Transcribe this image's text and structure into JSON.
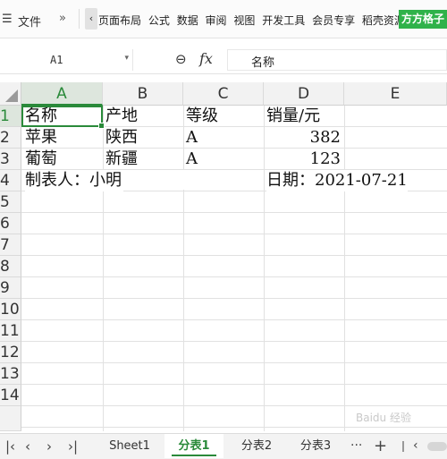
{
  "ribbon": {
    "file_label": "文件",
    "more_label": "»",
    "menus": [
      "页面布局",
      "公式",
      "数据",
      "审阅",
      "视图",
      "开发工具",
      "会员专享",
      "稻壳资源"
    ],
    "special_label": "方方格子"
  },
  "formula_bar": {
    "name_box": "A1",
    "fx_label": "fx",
    "content": "名称"
  },
  "columns": [
    "A",
    "B",
    "C",
    "D",
    "E"
  ],
  "rows": [
    "1",
    "2",
    "3",
    "4",
    "5",
    "6",
    "7",
    "8",
    "9",
    "10",
    "11",
    "12",
    "13",
    "14"
  ],
  "cells": {
    "r1": {
      "a": "名称",
      "b": "产地",
      "c": "等级",
      "d": "销量/元"
    },
    "r2": {
      "a": "苹果",
      "b": "陕西",
      "c": "A",
      "d": "382"
    },
    "r3": {
      "a": "葡萄",
      "b": "新疆",
      "c": "A",
      "d": "123"
    },
    "r4": {
      "a": "制表人：小明",
      "d": "日期：2021-07-21"
    }
  },
  "sheet_tabs": [
    "Sheet1",
    "分表1",
    "分表2",
    "分表3"
  ],
  "active_tab": "分表1",
  "colors": {
    "accent": "#2a8a3a",
    "special": "#2fb24a"
  }
}
